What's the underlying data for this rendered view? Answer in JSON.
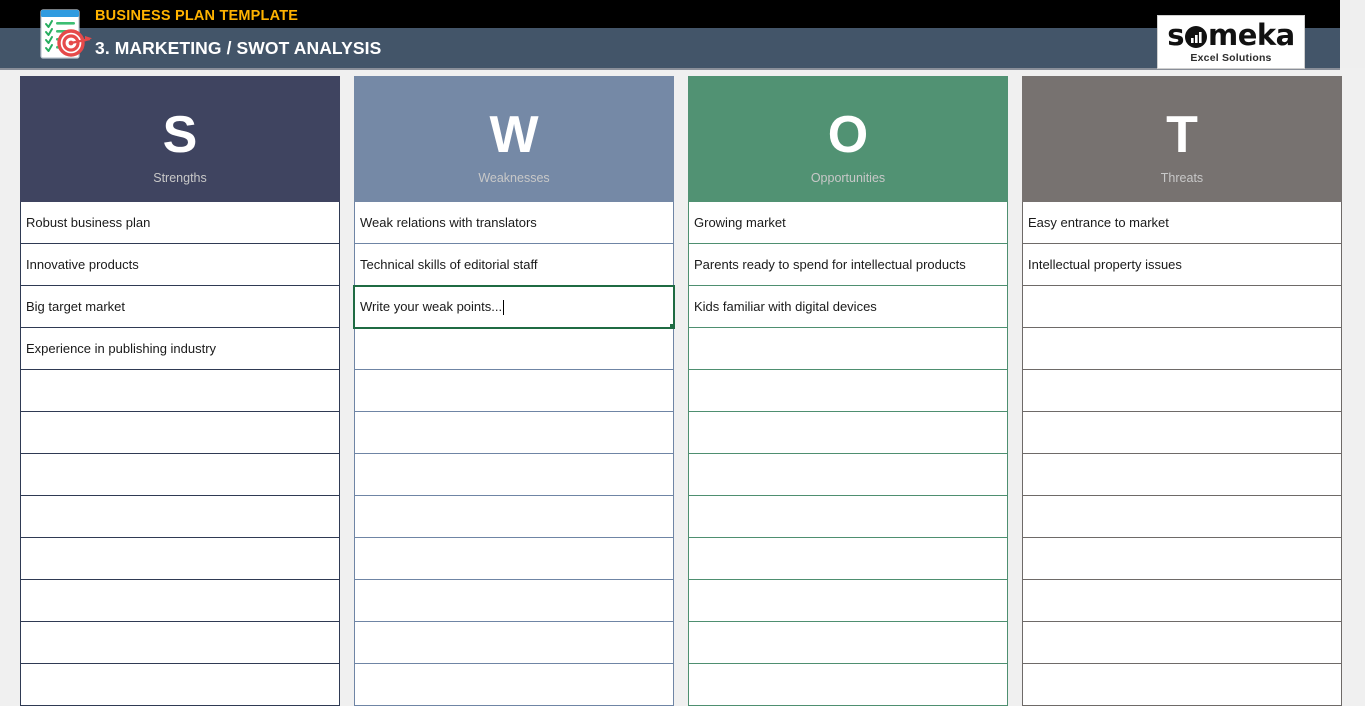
{
  "banner": {
    "template_label": "BUSINESS PLAN TEMPLATE",
    "page_title": "3. MARKETING / SWOT ANALYSIS",
    "template_label_color": "#FFB300",
    "bar_color": "#435569",
    "app_icon": "checklist-target-icon"
  },
  "logo": {
    "word": "someka",
    "tagline": "Excel Solutions"
  },
  "swot": {
    "columns": [
      {
        "key": "strengths",
        "letter": "S",
        "name": "Strengths",
        "header_color": "#3F4460",
        "border_color": "#2F3A53",
        "items": [
          "Robust business plan",
          "Innovative products",
          "Big target market",
          "Experience in publishing industry",
          "",
          "",
          "",
          "",
          "",
          "",
          "",
          ""
        ]
      },
      {
        "key": "weaknesses",
        "letter": "W",
        "name": "Weaknesses",
        "header_color": "#7589A6",
        "border_color": "#6F85A5",
        "items": [
          "Weak relations with translators",
          "Technical skills of editorial staff",
          "Write your weak points...",
          "",
          "",
          "",
          "",
          "",
          "",
          "",
          "",
          ""
        ],
        "selected_index": 2,
        "selection_color": "#1F6B43",
        "editing": true
      },
      {
        "key": "opportunities",
        "letter": "O",
        "name": "Opportunities",
        "header_color": "#519273",
        "border_color": "#4E8F70",
        "items": [
          "Growing market",
          "Parents ready to spend for intellectual products",
          "Kids familiar with digital devices",
          "",
          "",
          "",
          "",
          "",
          "",
          "",
          "",
          ""
        ]
      },
      {
        "key": "threats",
        "letter": "T",
        "name": "Threats",
        "header_color": "#777270",
        "border_color": "#6E6A68",
        "items": [
          "Easy entrance to market",
          "Intellectual property issues",
          "",
          "",
          "",
          "",
          "",
          "",
          "",
          "",
          "",
          ""
        ]
      }
    ]
  }
}
